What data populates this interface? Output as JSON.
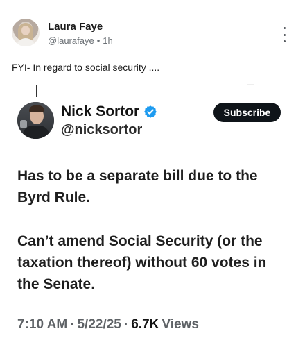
{
  "post": {
    "display_name": "Laura Faye",
    "handle": "@laurafaye",
    "separator": "•",
    "time": "1h",
    "text": "FYI- In regard to social security ...."
  },
  "embedded_tweet": {
    "display_name": "Nick Sortor",
    "handle": "@nicksortor",
    "subscribe_label": "Subscribe",
    "paragraphs": [
      "Has to be a separate bill due to the Byrd Rule.",
      "Can’t amend Social Security (or the taxation thereof) without 60 votes in the Senate."
    ],
    "time": "7:10 AM",
    "dot1": "·",
    "date": "5/22/25",
    "dot2": "·",
    "views_count": "6.7K",
    "views_label": "Views"
  },
  "colors": {
    "verified_blue": "#1d9bf0",
    "subscribe_bg": "#0f1419",
    "meta_gray": "#6b7075"
  },
  "icons": [
    "more-vertical-icon",
    "verified-badge-icon"
  ]
}
